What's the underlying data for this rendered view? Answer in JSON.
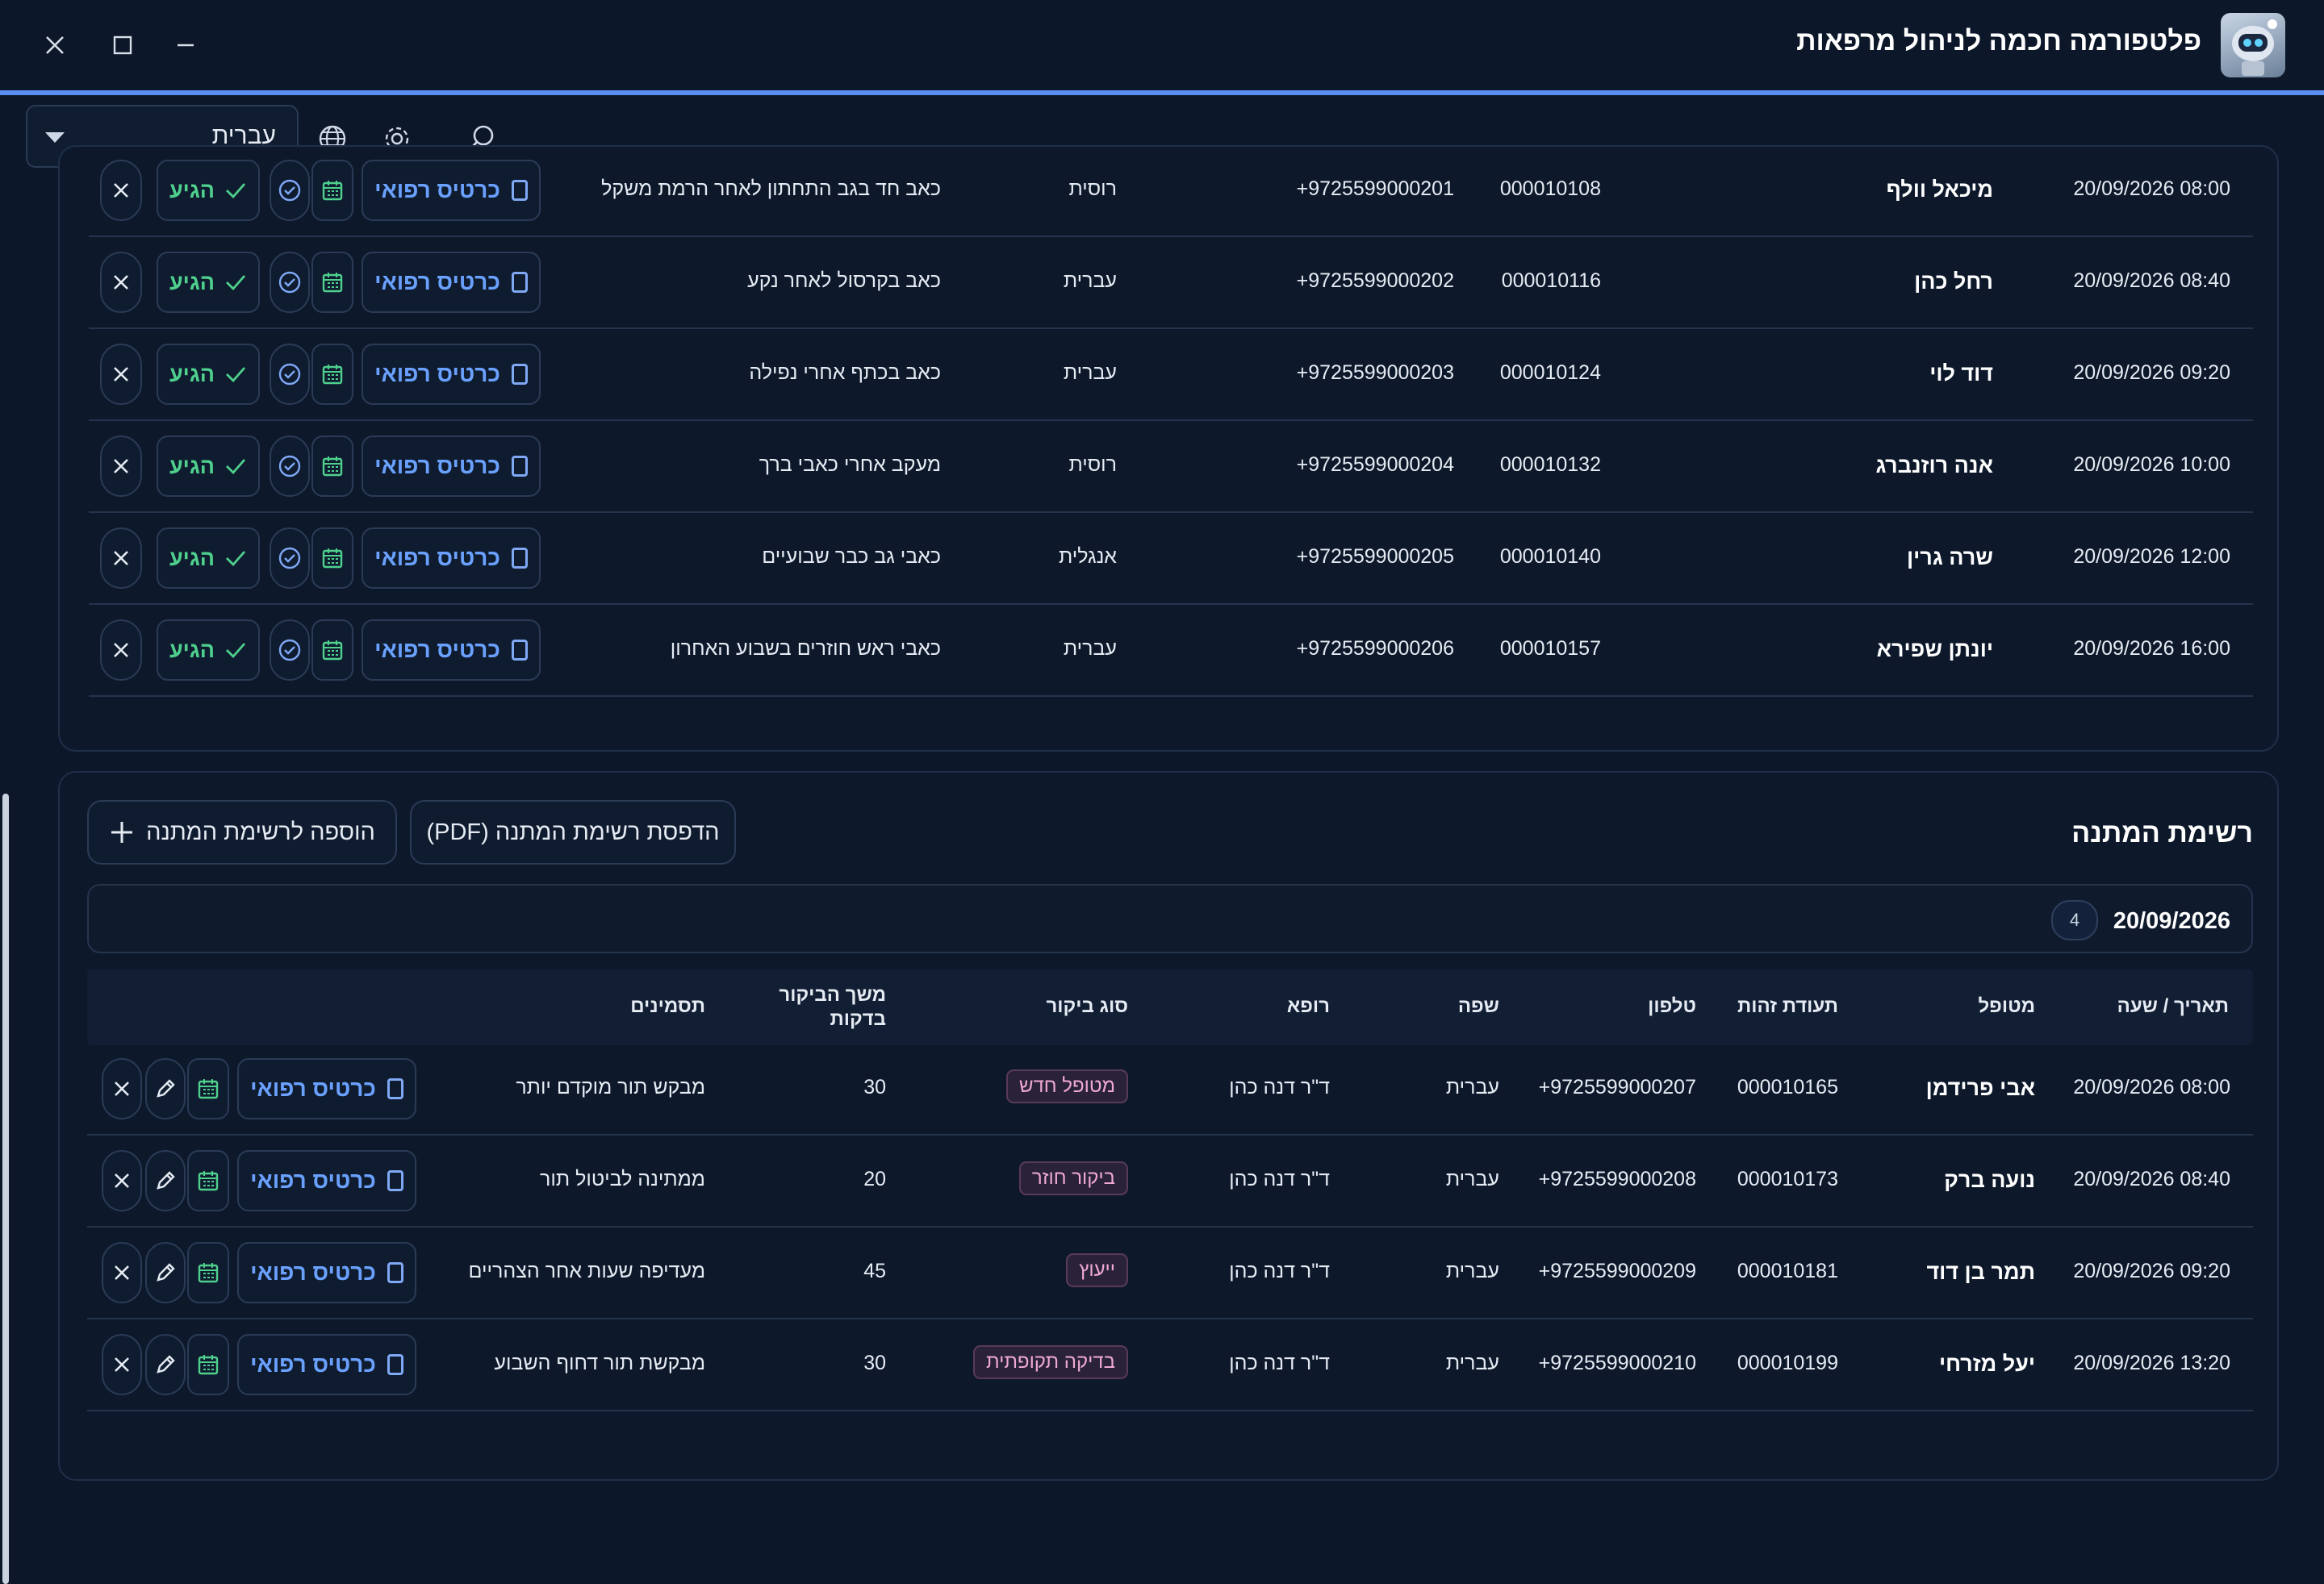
{
  "app": {
    "title": "פלטפורמה חכמה לניהול מרפאות"
  },
  "toolbar": {
    "language_value": "עברית"
  },
  "appointments": {
    "card_label": "כרטיס רפואי",
    "arrived_label": "הגיע",
    "rows": [
      {
        "datetime": "20/09/2026 08:00",
        "patient": "מיכאל וולף",
        "id_number": "000010108",
        "phone": "+9725599000201",
        "language": "רוסית",
        "notes": "כאב חד בגב התחתון לאחר הרמת משקל"
      },
      {
        "datetime": "20/09/2026 08:40",
        "patient": "רחל כהן",
        "id_number": "000010116",
        "phone": "+9725599000202",
        "language": "עברית",
        "notes": "כאב בקרסול לאחר נקע"
      },
      {
        "datetime": "20/09/2026 09:20",
        "patient": "דוד לוי",
        "id_number": "000010124",
        "phone": "+9725599000203",
        "language": "עברית",
        "notes": "כאב בכתף אחרי נפילה"
      },
      {
        "datetime": "20/09/2026 10:00",
        "patient": "אנה רוזנברג",
        "id_number": "000010132",
        "phone": "+9725599000204",
        "language": "רוסית",
        "notes": "מעקב אחרי כאבי ברך"
      },
      {
        "datetime": "20/09/2026 12:00",
        "patient": "שרה גרין",
        "id_number": "000010140",
        "phone": "+9725599000205",
        "language": "אנגלית",
        "notes": "כאבי גב כבר שבועיים"
      },
      {
        "datetime": "20/09/2026 16:00",
        "patient": "יונתן שפירא",
        "id_number": "000010157",
        "phone": "+9725599000206",
        "language": "עברית",
        "notes": "כאבי ראש חוזרים בשבוע האחרון"
      }
    ]
  },
  "waitlist": {
    "title": "רשימת המתנה",
    "print_button": "הדפסת רשימת המתנה (PDF)",
    "add_button": "הוספה לרשימת המתנה",
    "group_date": "20/09/2026",
    "group_count": "4",
    "card_label": "כרטיס רפואי",
    "headers": {
      "datetime": "תאריך / שעה",
      "patient": "מטופל",
      "id_number": "תעודת זהות",
      "phone": "טלפון",
      "language": "שפה",
      "doctor": "רופא",
      "visit_type": "סוג ביקור",
      "duration_line1": "משך הביקור",
      "duration_line2": "בדקות",
      "notes": "תסמינים"
    },
    "rows": [
      {
        "datetime": "20/09/2026 08:00",
        "patient": "אבי פרידמן",
        "id_number": "000010165",
        "phone": "+9725599000207",
        "language": "עברית",
        "doctor": "ד\"ר דנה כהן",
        "visit_type": "מטופל חדש",
        "duration": "30",
        "notes": "מבקש תור מוקדם יותר"
      },
      {
        "datetime": "20/09/2026 08:40",
        "patient": "נועה ברק",
        "id_number": "000010173",
        "phone": "+9725599000208",
        "language": "עברית",
        "doctor": "ד\"ר דנה כהן",
        "visit_type": "ביקור חוזר",
        "duration": "20",
        "notes": "ממתינה לביטול תור"
      },
      {
        "datetime": "20/09/2026 09:20",
        "patient": "תמר בן דוד",
        "id_number": "000010181",
        "phone": "+9725599000209",
        "language": "עברית",
        "doctor": "ד\"ר דנה כהן",
        "visit_type": "ייעוץ",
        "duration": "45",
        "notes": "מעדיפה שעות אחר הצהריים"
      },
      {
        "datetime": "20/09/2026 13:20",
        "patient": "יעל מזרחי",
        "id_number": "000010199",
        "phone": "+9725599000210",
        "language": "עברית",
        "doctor": "ד\"ר דנה כהן",
        "visit_type": "בדיקה תקופתית",
        "duration": "30",
        "notes": "מבקשת תור דחוף השבוע"
      }
    ]
  }
}
